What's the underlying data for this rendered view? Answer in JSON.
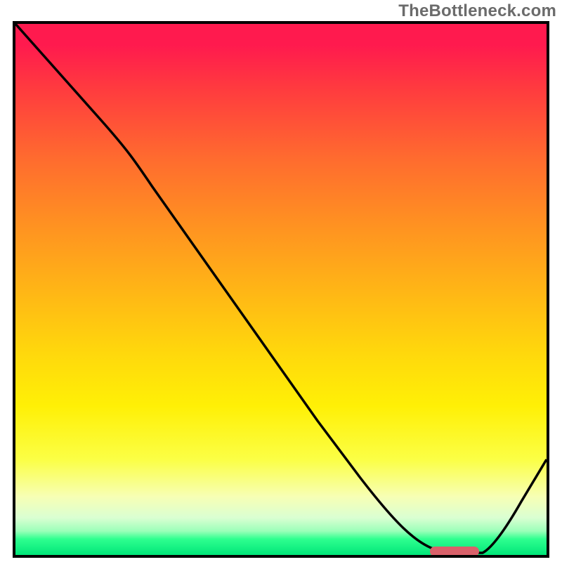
{
  "watermark": "TheBottleneck.com",
  "chart_data": {
    "type": "line",
    "title": "",
    "xlabel": "",
    "ylabel": "",
    "xlim": [
      0,
      100
    ],
    "ylim": [
      0,
      100
    ],
    "x": [
      0,
      5,
      10,
      15,
      20,
      25,
      30,
      35,
      40,
      45,
      50,
      55,
      60,
      65,
      70,
      75,
      80,
      82,
      85,
      90,
      95,
      100
    ],
    "values": [
      100,
      94,
      88,
      82,
      76,
      69,
      60,
      51,
      43,
      35,
      28,
      22,
      17,
      12,
      7,
      3,
      0.5,
      0,
      0,
      6,
      14,
      24
    ],
    "marker": {
      "x_start": 78,
      "x_end": 87,
      "y": 0.5
    },
    "gradient_stops": [
      {
        "pct": 0,
        "color": "#ff1a4e"
      },
      {
        "pct": 50,
        "color": "#ffd80c"
      },
      {
        "pct": 90,
        "color": "#f7ffb4"
      },
      {
        "pct": 100,
        "color": "#00e679"
      }
    ]
  }
}
